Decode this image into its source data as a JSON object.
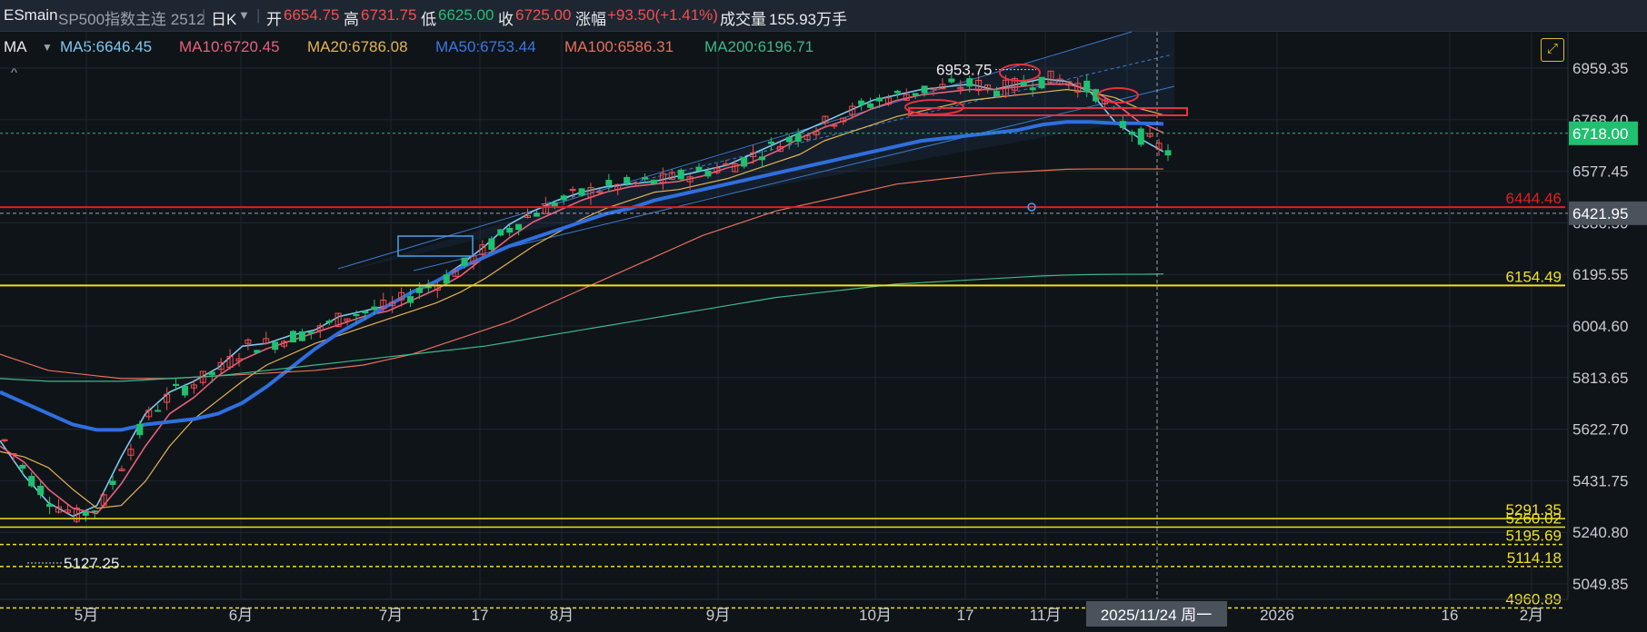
{
  "header": {
    "symbol": "ESmain",
    "name": "SP500指数主连 2512",
    "period": "日K",
    "period_arrow": "▼",
    "open_label": "开",
    "open": "6654.75",
    "high_label": "高",
    "high": "6731.75",
    "low_label": "低",
    "low": "6625.00",
    "close_label": "收",
    "close": "6725.00",
    "change_label": "涨幅",
    "change": "+93.50(+1.41%)",
    "volume_label": "成交量",
    "volume": "155.93万手"
  },
  "ma_bar": {
    "label": "MA",
    "arrow": "▼",
    "items": [
      {
        "text": "MA5:6646.45",
        "color": "#7ec8f0"
      },
      {
        "text": "MA10:6720.45",
        "color": "#e8607a"
      },
      {
        "text": "MA20:6786.08",
        "color": "#e6b450"
      },
      {
        "text": "MA50:6753.44",
        "color": "#3a78e0"
      },
      {
        "text": "MA100:6586.31",
        "color": "#e8705a"
      },
      {
        "text": "MA200:6196.71",
        "color": "#3cb88a"
      }
    ]
  },
  "controls": {
    "expand_icon": "expand-icon",
    "collapse_icon": "caret-up-icon",
    "collapse_glyph": "^",
    "expand_glyph": "⤢"
  },
  "chart_data": {
    "type": "candlestick",
    "price_axis": {
      "ticks": [
        "6959.35",
        "6768.40",
        "6577.45",
        "6386.50",
        "6195.55",
        "6004.60",
        "5813.65",
        "5622.70",
        "5431.75",
        "5240.80",
        "5049.85"
      ],
      "range": [
        5000,
        7030
      ]
    },
    "time_axis": {
      "labels": [
        "5月",
        "6月",
        "7月",
        "17",
        "8月",
        "9月",
        "10月",
        "17",
        "11月",
        "16",
        "2026",
        "16",
        "2月"
      ],
      "crosshair_label": "2025/11/24 周一"
    },
    "current_price": {
      "value": 6718.0,
      "label": "6718.00",
      "color": "#20c070"
    },
    "crosshair_price": {
      "value": 6421.95,
      "label": "6421.95"
    },
    "horizontal_levels": [
      {
        "value": 6444.46,
        "label": "6444.46",
        "color": "#e02020"
      },
      {
        "value": 6154.49,
        "label": "6154.49",
        "color": "#f0e020"
      },
      {
        "value": 5291.35,
        "label": "5291.35",
        "color": "#f0e020"
      },
      {
        "value": 5260.02,
        "label": "5260.02",
        "color": "#f0e020"
      },
      {
        "value": 5195.69,
        "label": "5195.69",
        "color": "#f0e020"
      },
      {
        "value": 5114.18,
        "label": "5114.18",
        "color": "#f0e020"
      },
      {
        "value": 4960.89,
        "label": "4960.89",
        "color": "#f0e020"
      }
    ],
    "annotations": [
      {
        "text": "6953.75",
        "value": 6953.75,
        "kind": "high"
      },
      {
        "text": "5127.25",
        "value": 5127.25,
        "kind": "low"
      }
    ],
    "series": [
      {
        "name": "MA5",
        "color": "#7ec8f0",
        "values": [
          5580,
          5450,
          5350,
          5300,
          5340,
          5520,
          5680,
          5760,
          5800,
          5850,
          5930,
          5940,
          5970,
          5990,
          6040,
          6060,
          6080,
          6130,
          6170,
          6230,
          6300,
          6380,
          6430,
          6470,
          6500,
          6520,
          6530,
          6540,
          6560,
          6580,
          6600,
          6640,
          6680,
          6720,
          6760,
          6800,
          6840,
          6860,
          6880,
          6890,
          6900,
          6880,
          6900,
          6920,
          6910,
          6870,
          6760,
          6700,
          6650
        ]
      },
      {
        "name": "MA10",
        "color": "#e8607a",
        "values": [
          5560,
          5500,
          5400,
          5330,
          5310,
          5420,
          5560,
          5680,
          5740,
          5820,
          5880,
          5920,
          5950,
          5980,
          6010,
          6040,
          6060,
          6100,
          6140,
          6190,
          6260,
          6330,
          6390,
          6430,
          6470,
          6500,
          6520,
          6530,
          6540,
          6560,
          6590,
          6610,
          6650,
          6700,
          6740,
          6770,
          6810,
          6840,
          6860,
          6870,
          6880,
          6880,
          6890,
          6900,
          6900,
          6880,
          6830,
          6760,
          6720
        ]
      },
      {
        "name": "MA20",
        "color": "#e6b450",
        "values": [
          5540,
          5520,
          5480,
          5400,
          5330,
          5340,
          5430,
          5560,
          5660,
          5730,
          5800,
          5860,
          5900,
          5940,
          5970,
          6000,
          6030,
          6060,
          6090,
          6130,
          6180,
          6240,
          6300,
          6350,
          6400,
          6440,
          6470,
          6500,
          6510,
          6530,
          6550,
          6580,
          6610,
          6640,
          6690,
          6720,
          6750,
          6780,
          6800,
          6820,
          6840,
          6850,
          6860,
          6870,
          6880,
          6870,
          6850,
          6810,
          6786
        ]
      },
      {
        "name": "MA50",
        "color": "#2f6fe0",
        "values": [
          5760,
          5720,
          5680,
          5640,
          5620,
          5620,
          5640,
          5650,
          5660,
          5680,
          5720,
          5780,
          5850,
          5920,
          5980,
          6030,
          6080,
          6130,
          6170,
          6220,
          6260,
          6300,
          6330,
          6360,
          6390,
          6420,
          6440,
          6470,
          6490,
          6510,
          6530,
          6550,
          6570,
          6590,
          6610,
          6630,
          6650,
          6670,
          6690,
          6700,
          6710,
          6720,
          6730,
          6750,
          6760,
          6760,
          6755,
          6755,
          6753
        ]
      },
      {
        "name": "MA100",
        "color": "#e8705a",
        "values": [
          5900,
          5870,
          5840,
          5830,
          5820,
          5810,
          5810,
          5810,
          5815,
          5820,
          5825,
          5830,
          5835,
          5840,
          5850,
          5860,
          5880,
          5900,
          5930,
          5960,
          5990,
          6020,
          6060,
          6100,
          6140,
          6180,
          6220,
          6260,
          6300,
          6340,
          6370,
          6400,
          6430,
          6450,
          6470,
          6490,
          6510,
          6530,
          6540,
          6550,
          6560,
          6570,
          6575,
          6580,
          6585,
          6586,
          6586,
          6586,
          6586
        ]
      },
      {
        "name": "MA200",
        "color": "#3cb88a",
        "values": [
          5810,
          5805,
          5800,
          5800,
          5800,
          5800,
          5805,
          5810,
          5815,
          5820,
          5830,
          5840,
          5850,
          5860,
          5870,
          5880,
          5890,
          5900,
          5910,
          5920,
          5930,
          5945,
          5960,
          5975,
          5990,
          6005,
          6020,
          6035,
          6050,
          6065,
          6080,
          6095,
          6110,
          6120,
          6130,
          6140,
          6150,
          6160,
          6165,
          6170,
          6175,
          6180,
          6185,
          6190,
          6193,
          6195,
          6196,
          6196,
          6197
        ]
      }
    ]
  }
}
